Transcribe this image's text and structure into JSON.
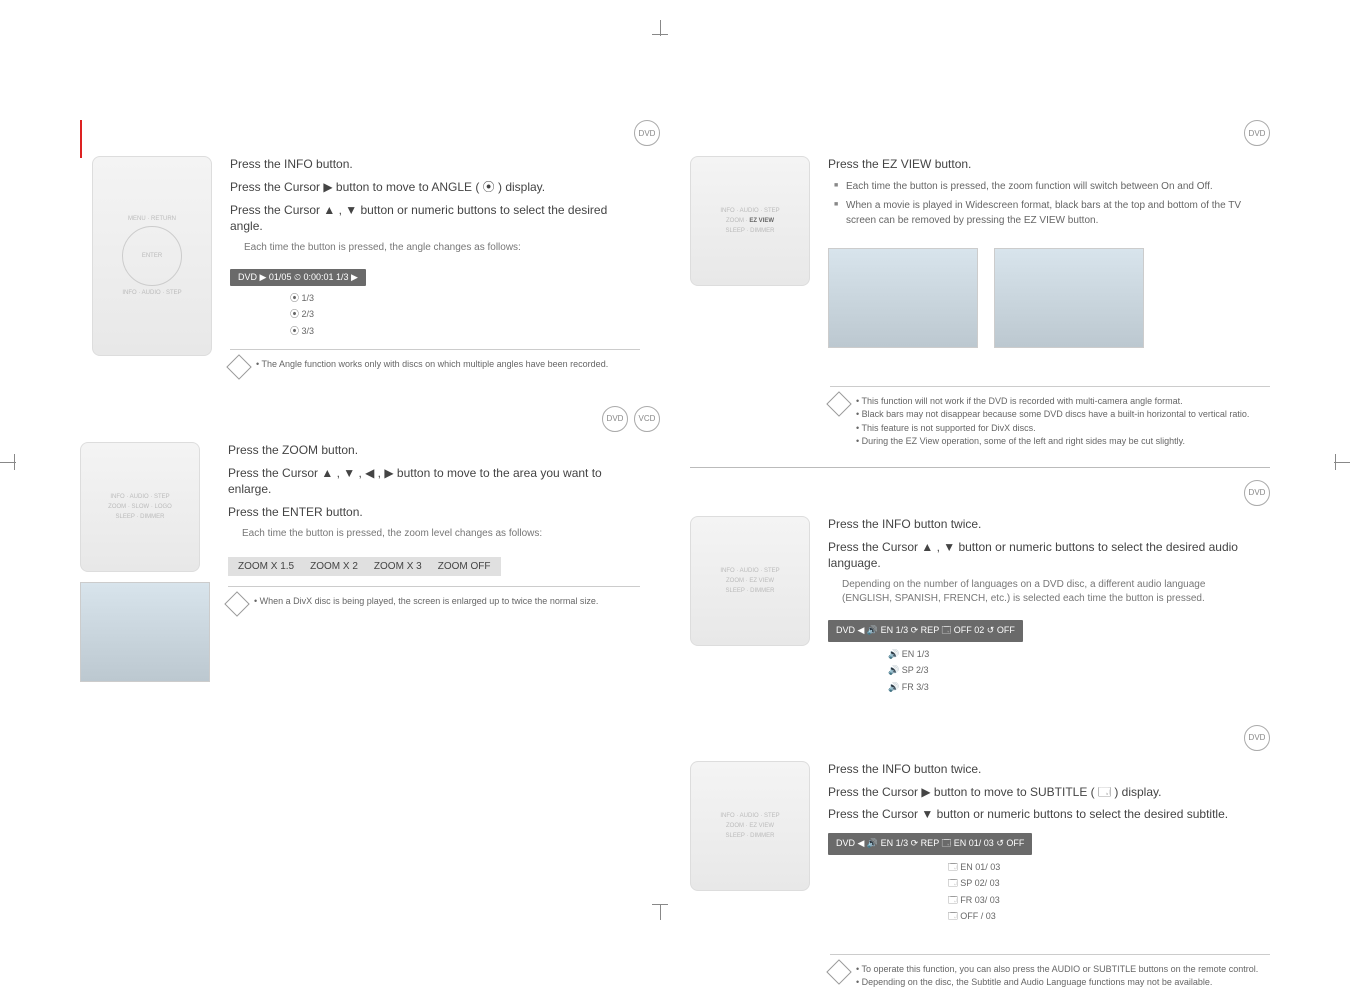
{
  "left": {
    "angle": {
      "disc_icon": "DVD",
      "step1": "Press the INFO button.",
      "step2": "Press the Cursor ▶ button to move to ANGLE ( ⦿ ) display.",
      "step3": "Press the Cursor ▲ , ▼ button or numeric buttons to select the desired angle.",
      "step3_sub": "Each time the button is pressed, the angle changes as follows:",
      "osd": "DVD  ▶ 01/05  ⏲ 0:00:01    1/3 ▶",
      "chain": [
        "⦿ 1/3",
        "⦿ 2/3",
        "⦿ 3/3"
      ],
      "note": "The Angle function works only with discs on which multiple angles have been recorded."
    },
    "zoom": {
      "disc_icons": [
        "DVD",
        "VCD"
      ],
      "step1": "Press the ZOOM button.",
      "step2": "Press the Cursor ▲ , ▼ , ◀ , ▶ button to move to the area you want to enlarge.",
      "step3": "Press the ENTER button.",
      "step3_sub": "Each time the button is pressed, the zoom level changes as follows:",
      "levels": [
        "ZOOM X 1.5",
        "ZOOM X 2",
        "ZOOM X 3",
        "ZOOM OFF"
      ],
      "note": "When a DivX disc is being played, the screen is enlarged up to twice the normal size."
    }
  },
  "right": {
    "ezview": {
      "disc_icon": "DVD",
      "step1": "Press the EZ VIEW button.",
      "bullet1": "Each time the button is pressed, the zoom function will switch between On and Off.",
      "bullet2": "When a movie is played in Widescreen format, black bars at the top and bottom of the TV screen can be removed by pressing the EZ VIEW button.",
      "notes": [
        "This function will not work if the DVD is recorded with multi-camera angle format.",
        "Black bars may not disappear because some DVD discs have a built-in horizontal to vertical ratio.",
        "This feature is not supported for DivX discs.",
        "During the EZ View operation, some of the left and right sides may be cut slightly."
      ]
    },
    "audio": {
      "disc_icon": "DVD",
      "step1": "Press the INFO button twice.",
      "step2": "Press the Cursor ▲ , ▼ button or numeric buttons to select the desired audio language.",
      "step2_sub": "Depending on the number of languages on a DVD disc, a different audio language (ENGLISH, SPANISH, FRENCH, etc.) is selected each time the button is pressed.",
      "osd": "DVD  ◀  🔊 EN 1/3  ⟳ REP   🗔 OFF  02   ↺ OFF",
      "chain": [
        "🔊 EN 1/3",
        "🔊 SP 2/3",
        "🔊 FR 3/3"
      ]
    },
    "subtitle": {
      "disc_icon": "DVD",
      "step1": "Press the INFO button twice.",
      "step2": "Press the Cursor ▶ button to move to SUBTITLE ( 🗔 ) display.",
      "step3": "Press the Cursor ▼ button or numeric buttons to select the desired subtitle.",
      "osd": "DVD ◀ 🔊 EN 1/3  ⟳ REP   🗔 EN 01/ 03  ↺ OFF",
      "chain": [
        "🗔 EN 01/ 03",
        "🗔 SP 02/ 03",
        "🗔 FR 03/ 03",
        "🗔 OFF / 03"
      ],
      "notes": [
        "To operate this function, you can also press the AUDIO or SUBTITLE buttons on the remote control.",
        "Depending on the disc, the Subtitle and Audio Language functions may not be available."
      ]
    }
  }
}
